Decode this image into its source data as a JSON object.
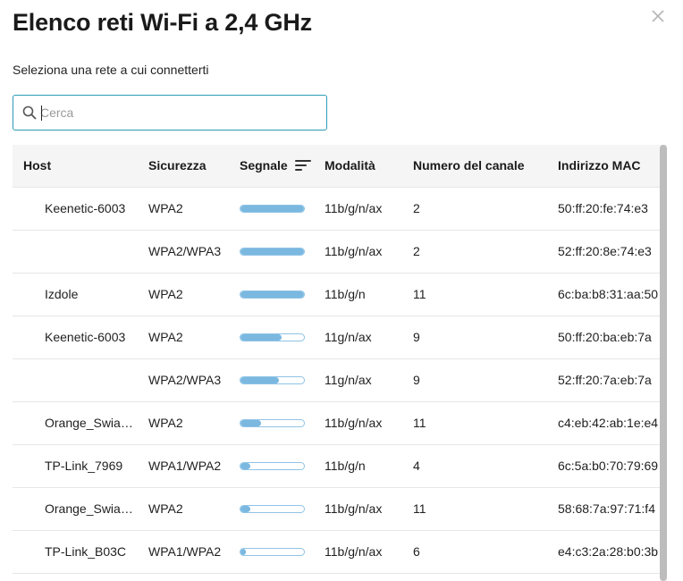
{
  "dialog": {
    "title": "Elenco reti Wi-Fi a 2,4 GHz",
    "subtitle": "Seleziona una rete a cui connetterti",
    "close_icon": "close-icon"
  },
  "search": {
    "placeholder": "Cerca",
    "value": "",
    "icon": "search-icon"
  },
  "table": {
    "columns": {
      "host": "Host",
      "security": "Sicurezza",
      "signal": "Segnale",
      "mode": "Modalità",
      "channel": "Numero del canale",
      "mac": "Indirizzo MAC"
    },
    "sort_icon": "sort-icon",
    "rows": [
      {
        "host": "Keenetic-6003",
        "security": "WPA2",
        "signal": 1.0,
        "mode": "11b/g/n/ax",
        "channel": "2",
        "mac": "50:ff:20:fe:74:e3"
      },
      {
        "host": "",
        "security": "WPA2/WPA3",
        "signal": 1.0,
        "mode": "11b/g/n/ax",
        "channel": "2",
        "mac": "52:ff:20:8e:74:e3"
      },
      {
        "host": "Izdole",
        "security": "WPA2",
        "signal": 1.0,
        "mode": "11b/g/n",
        "channel": "11",
        "mac": "6c:ba:b8:31:aa:50"
      },
      {
        "host": "Keenetic-6003",
        "security": "WPA2",
        "signal": 0.65,
        "mode": "11g/n/ax",
        "channel": "9",
        "mac": "50:ff:20:ba:eb:7a"
      },
      {
        "host": "",
        "security": "WPA2/WPA3",
        "signal": 0.6,
        "mode": "11g/n/ax",
        "channel": "9",
        "mac": "52:ff:20:7a:eb:7a"
      },
      {
        "host": "Orange_Swia…",
        "security": "WPA2",
        "signal": 0.32,
        "mode": "11b/g/n/ax",
        "channel": "11",
        "mac": "c4:eb:42:ab:1e:e4"
      },
      {
        "host": "TP-Link_7969",
        "security": "WPA1/WPA2",
        "signal": 0.15,
        "mode": "11b/g/n",
        "channel": "4",
        "mac": "6c:5a:b0:70:79:69"
      },
      {
        "host": "Orange_Swia…",
        "security": "WPA2",
        "signal": 0.15,
        "mode": "11b/g/n/ax",
        "channel": "11",
        "mac": "58:68:7a:97:71:f4"
      },
      {
        "host": "TP-Link_B03C",
        "security": "WPA1/WPA2",
        "signal": 0.08,
        "mode": "11b/g/n/ax",
        "channel": "6",
        "mac": "e4:c3:2a:28:b0:3b"
      }
    ]
  },
  "colors": {
    "accent": "#2d9bb7",
    "signal_fill": "#7ab8e0",
    "signal_border": "#8fc3e6",
    "header_bg": "#f5f5f5",
    "divider": "#e6e6e6"
  }
}
